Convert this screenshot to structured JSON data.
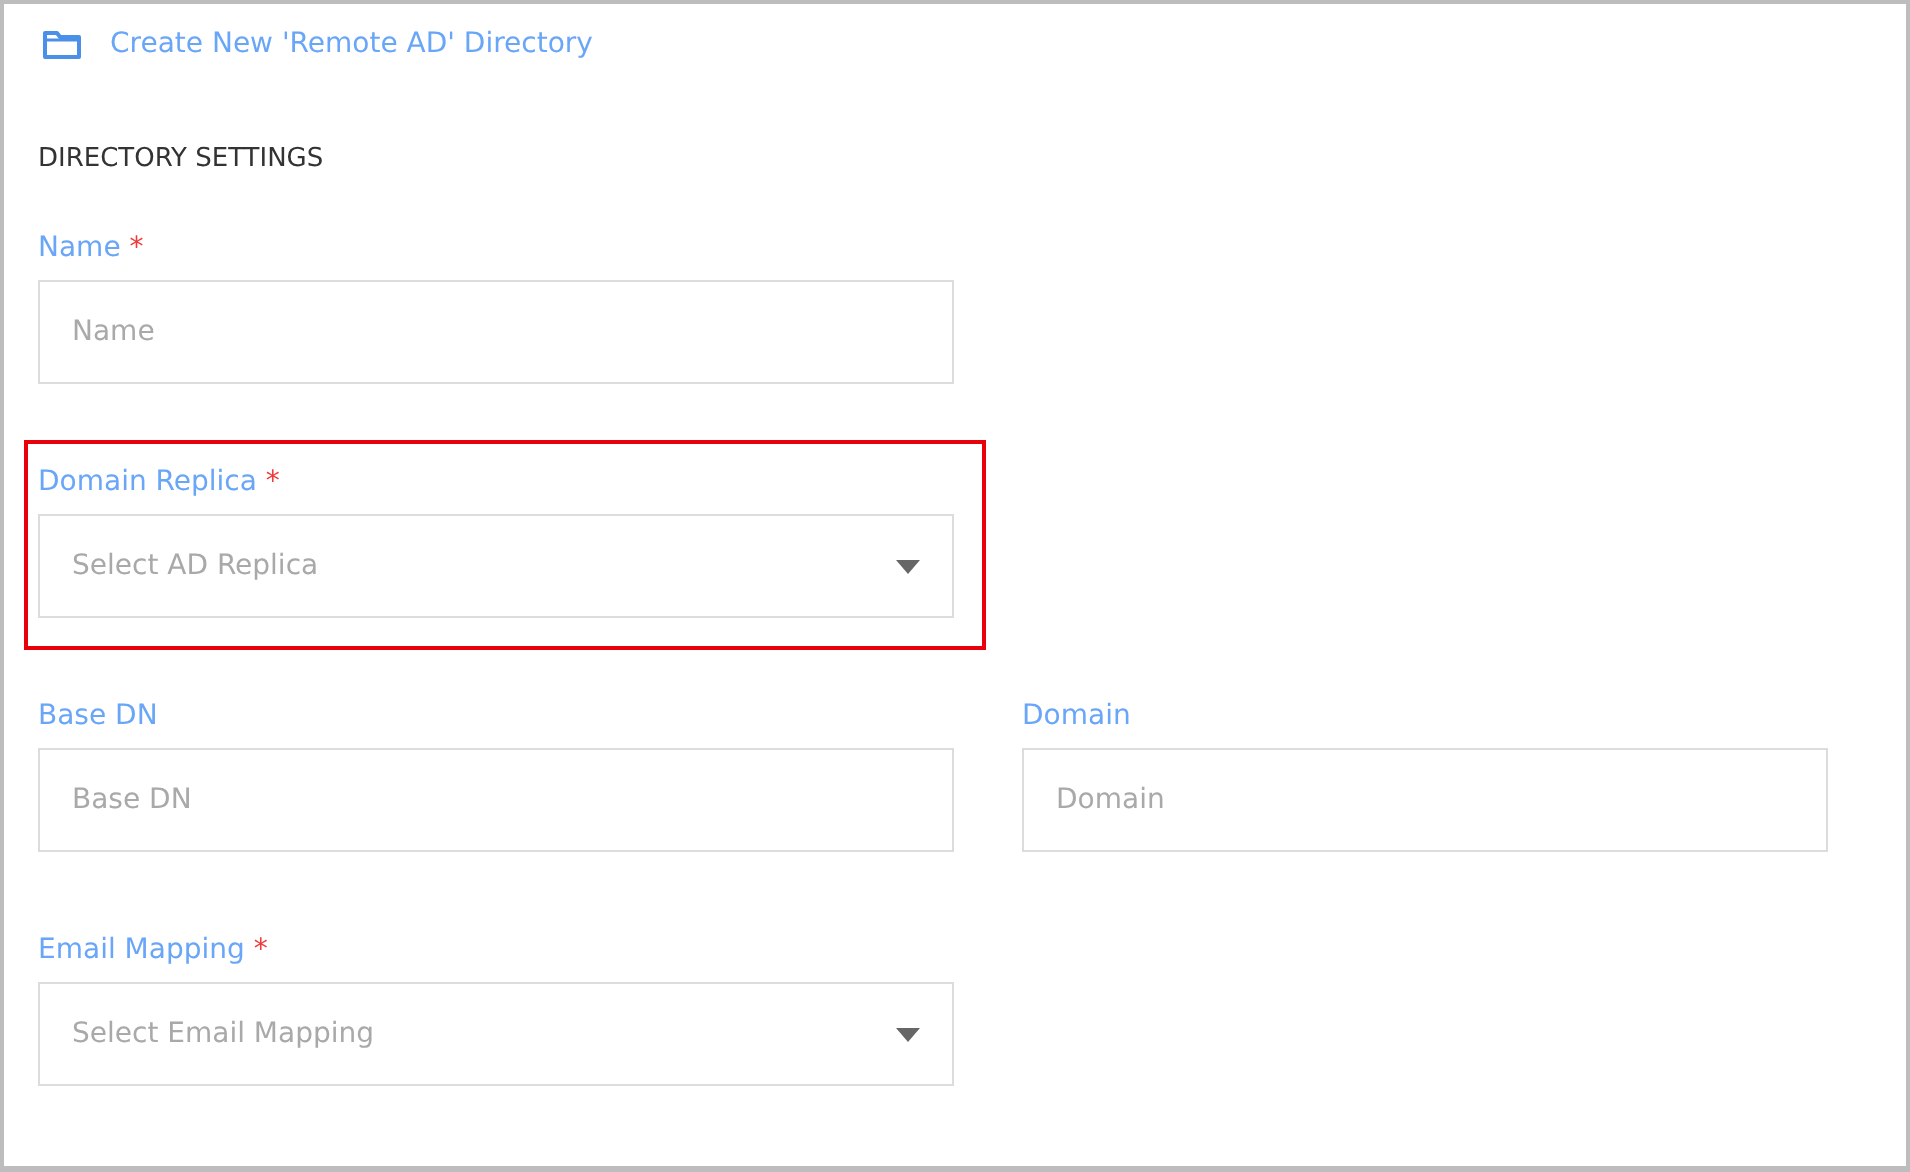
{
  "header": {
    "title": "Create New 'Remote AD' Directory"
  },
  "section_heading": "DIRECTORY SETTINGS",
  "rows": [
    {
      "fields": [
        {
          "label": "Name",
          "required": true,
          "kind": "text",
          "placeholder": "Name",
          "highlighted": false
        }
      ]
    },
    {
      "fields": [
        {
          "label": "Domain Replica",
          "required": true,
          "kind": "select",
          "placeholder": "Select AD Replica",
          "highlighted": true
        }
      ]
    },
    {
      "fields": [
        {
          "label": "Base DN",
          "required": false,
          "kind": "text",
          "placeholder": "Base DN",
          "highlighted": false
        },
        {
          "label": "Domain",
          "required": false,
          "kind": "text",
          "placeholder": "Domain",
          "highlighted": false
        }
      ]
    },
    {
      "fields": [
        {
          "label": "Email Mapping",
          "required": true,
          "kind": "select",
          "placeholder": "Select Email Mapping",
          "highlighted": false
        }
      ]
    }
  ],
  "required_mark": "*"
}
